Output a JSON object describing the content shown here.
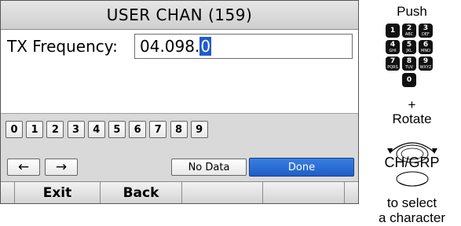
{
  "screen": {
    "title": "USER CHAN (159)",
    "frequency_label": "TX Frequency:",
    "frequency_value": "04.098.",
    "frequency_cursor_char": "0",
    "digits": [
      "0",
      "1",
      "2",
      "3",
      "4",
      "5",
      "6",
      "7",
      "8",
      "9"
    ],
    "left_arrow": "←",
    "right_arrow": "→",
    "no_data_label": "No Data",
    "done_label": "Done",
    "softkeys": [
      "Exit",
      "Back",
      "",
      ""
    ]
  },
  "guide": {
    "push": "Push",
    "keypad": [
      {
        "digit": "1",
        "letters": ""
      },
      {
        "digit": "2",
        "letters": "ABC"
      },
      {
        "digit": "3",
        "letters": "DEF"
      },
      {
        "digit": "4",
        "letters": "GHI"
      },
      {
        "digit": "5",
        "letters": "JKL"
      },
      {
        "digit": "6",
        "letters": "MNO"
      },
      {
        "digit": "7",
        "letters": "PQRS"
      },
      {
        "digit": "8",
        "letters": "TUV"
      },
      {
        "digit": "9",
        "letters": "WXYZ"
      },
      {
        "digit": "0",
        "letters": ""
      }
    ],
    "plus": "+",
    "rotate": "Rotate",
    "knob_label": "CH/GRP",
    "to_select": "to select",
    "a_character": "a character"
  },
  "colors": {
    "done_button": "#1f5ec9",
    "cursor_highlight": "#1e5ccc",
    "titlebar": "#d6d6d6",
    "keypad_panel": "#d9d9d9"
  }
}
